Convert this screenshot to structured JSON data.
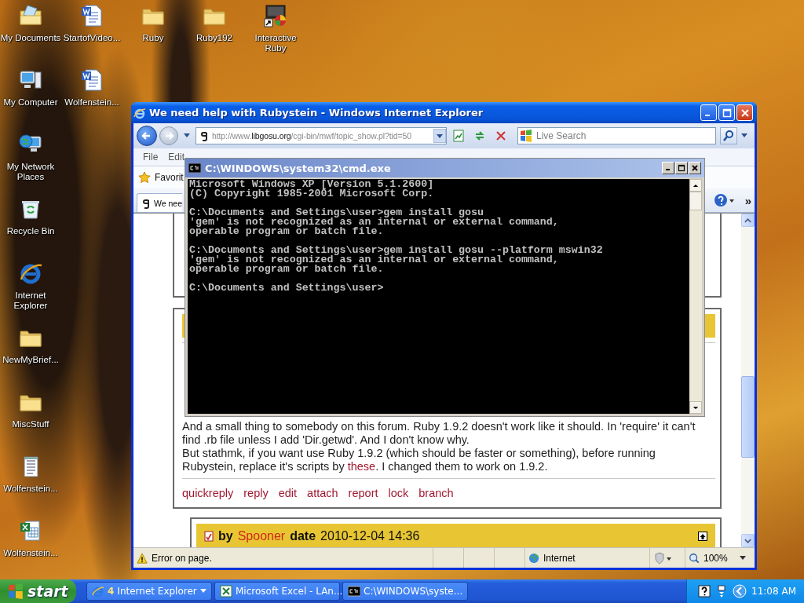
{
  "desktop": {
    "icon_columns": [
      [
        {
          "label": "My Documents",
          "kind": "mydocs"
        },
        {
          "label": "My Computer",
          "kind": "computer"
        },
        {
          "label": "My Network Places",
          "kind": "network"
        },
        {
          "label": "Recycle Bin",
          "kind": "recycle"
        },
        {
          "label": "Internet Explorer",
          "kind": "ie"
        },
        {
          "label": "NewMyBrief...",
          "kind": "folder"
        },
        {
          "label": "MiscStuff",
          "kind": "folder"
        },
        {
          "label": "Wolfenstein...",
          "kind": "notepad"
        },
        {
          "label": "Wolfenstein...",
          "kind": "excel"
        }
      ],
      [
        {
          "label": "StartofVideo...",
          "kind": "word"
        },
        {
          "label": "Wolfenstein...",
          "kind": "word"
        }
      ],
      [
        {
          "label": "Ruby",
          "kind": "folder"
        }
      ],
      [
        {
          "label": "Ruby192",
          "kind": "folder"
        }
      ],
      [
        {
          "label": "Interactive Ruby",
          "kind": "irb"
        }
      ]
    ]
  },
  "browser": {
    "title": "We need help with Rubystein - Windows Internet Explorer",
    "address": "http://www.**libgosu.org**/cgi-bin/mwf/topic_show.pl?tid=50",
    "search": {
      "placeholder": "Live Search"
    },
    "menu": [
      "File",
      "Edit"
    ],
    "favorites": "Favorit",
    "tab": "We nee",
    "chevron": "»",
    "post": {
      "paragraphs": [
        {
          "before": "And a small thing to somebody on this forum. Ruby 1.9.2 doesn't work like it should. In 'require' it can't find .rb file unless I add 'Dir.getwd'. And I don't know why."
        },
        {
          "before": "But stathmk, if you want use Ruby 1.9.2 (which should be faster or something), before running Rubystein, replace it's scripts by ",
          "link": "these",
          "after": ". I changed them to work on 1.9.2."
        }
      ],
      "actions": [
        "quickreply",
        "reply",
        "edit",
        "attach",
        "report",
        "lock",
        "branch"
      ]
    },
    "next_post": {
      "by_label": "by",
      "author": "Spooner",
      "date_label": "date",
      "date": "2010-12-04 14:36"
    },
    "status_bar": {
      "message": "Error on page.",
      "zone": "Internet",
      "zoom": "100%"
    }
  },
  "console": {
    "title": "C:\\WINDOWS\\system32\\cmd.exe",
    "blocks": [
      [
        "Microsoft Windows XP [Version 5.1.2600]",
        "(C) Copyright 1985-2001 Microsoft Corp."
      ],
      [
        "C:\\Documents and Settings\\user>gem install gosu",
        "'gem' is not recognized as an internal or external command,",
        "operable program or batch file."
      ],
      [
        "C:\\Documents and Settings\\user>gem install gosu --platform mswin32",
        "'gem' is not recognized as an internal or external command,",
        "operable program or batch file."
      ],
      [
        "C:\\Documents and Settings\\user>"
      ]
    ]
  },
  "taskbar": {
    "start": "start",
    "tasks": [
      {
        "kind": "ie",
        "count": "4",
        "label": "Internet Explorer"
      },
      {
        "kind": "excel",
        "label": "Microsoft Excel - LAn..."
      },
      {
        "kind": "cmd",
        "label": "C:\\WINDOWS\\syste..."
      }
    ],
    "clock": "11:08 AM"
  }
}
